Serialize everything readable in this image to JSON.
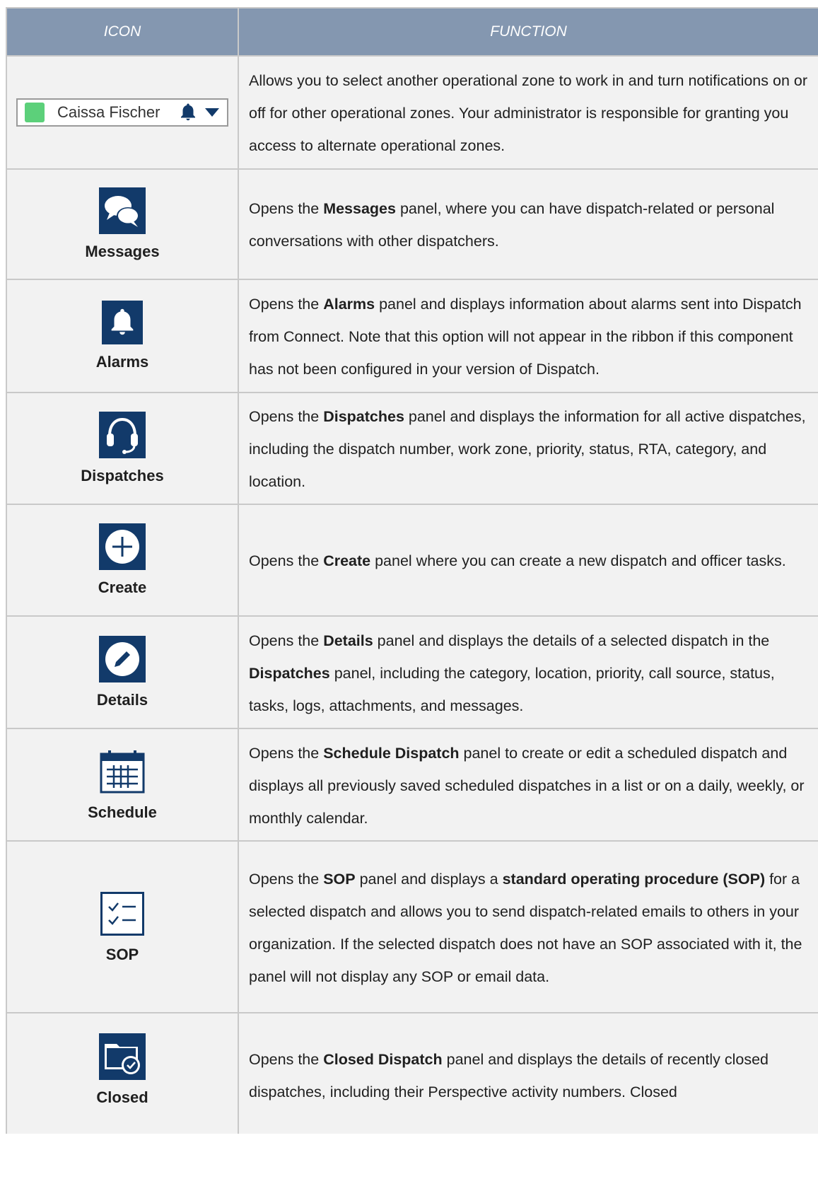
{
  "header": {
    "icon_col": "ICON",
    "function_col": "FUNCTION"
  },
  "zone_selector": {
    "name": "Caissa Fischer",
    "swatch_color": "#5cd07a"
  },
  "colors": {
    "header_bg": "#8497b0",
    "row_bg": "#f2f2f2",
    "icon_tile": "#123a6a",
    "border": "#c9c9c9"
  },
  "rows": [
    {
      "icon": "zone-selector",
      "label": "",
      "text": [
        {
          "t": "Allows you to select another operational zone to work in and turn notifications on or off for other operational zones. Your administrator is responsible for granting you access to alternate operational zones."
        }
      ]
    },
    {
      "icon": "messages-icon",
      "label": "Messages",
      "text": [
        {
          "t": "Opens the "
        },
        {
          "t": "Messages",
          "b": true
        },
        {
          "t": " panel, where you can have dispatch-related or personal conversations with other dispatchers."
        }
      ]
    },
    {
      "icon": "alarms-icon",
      "label": "Alarms",
      "text": [
        {
          "t": "Opens the "
        },
        {
          "t": "Alarms",
          "b": true
        },
        {
          "t": " panel and displays information about alarms sent into Dispatch from Connect. Note that this option will not appear in the ribbon if this component has not been configured in your version of Dispatch."
        }
      ]
    },
    {
      "icon": "dispatches-icon",
      "label": "Dispatches",
      "text": [
        {
          "t": "Opens the "
        },
        {
          "t": "Dispatches",
          "b": true
        },
        {
          "t": " panel and displays the information for all active dispatches, including the dispatch number, work zone, priority, status, RTA, category, and location."
        }
      ]
    },
    {
      "icon": "create-icon",
      "label": "Create",
      "text": [
        {
          "t": "Opens the "
        },
        {
          "t": "Create",
          "b": true
        },
        {
          "t": " panel where you can create a new dispatch and officer tasks."
        }
      ]
    },
    {
      "icon": "details-icon",
      "label": "Details",
      "text": [
        {
          "t": "Opens the "
        },
        {
          "t": "Details",
          "b": true
        },
        {
          "t": " panel and displays the details of a selected dispatch in the "
        },
        {
          "t": "Dispatches",
          "b": true
        },
        {
          "t": " panel, including the category, location, priority, call source, status, tasks, logs, attachments, and messages."
        }
      ]
    },
    {
      "icon": "schedule-icon",
      "label": "Schedule",
      "text": [
        {
          "t": "Opens the "
        },
        {
          "t": "Schedule Dispatch",
          "b": true
        },
        {
          "t": " panel to create or edit a scheduled dispatch and displays all previously saved scheduled dispatches in a list or on a daily, weekly, or monthly calendar."
        }
      ]
    },
    {
      "icon": "sop-icon",
      "label": "SOP",
      "text": [
        {
          "t": "Opens the "
        },
        {
          "t": "SOP",
          "b": true
        },
        {
          "t": " panel and displays a "
        },
        {
          "t": "standard operating procedure (SOP)",
          "b": true
        },
        {
          "t": " for a selected dispatch and allows you to send dispatch-related emails to others in your organization. If the selected dispatch does not have an SOP associated with it, the panel will not display any SOP or email data."
        }
      ]
    },
    {
      "icon": "closed-icon",
      "label": "Closed",
      "text": [
        {
          "t": "Opens the "
        },
        {
          "t": "Closed Dispatch",
          "b": true
        },
        {
          "t": " panel and displays the details of recently closed dispatches, including their Perspective activity numbers. Closed"
        }
      ]
    }
  ]
}
